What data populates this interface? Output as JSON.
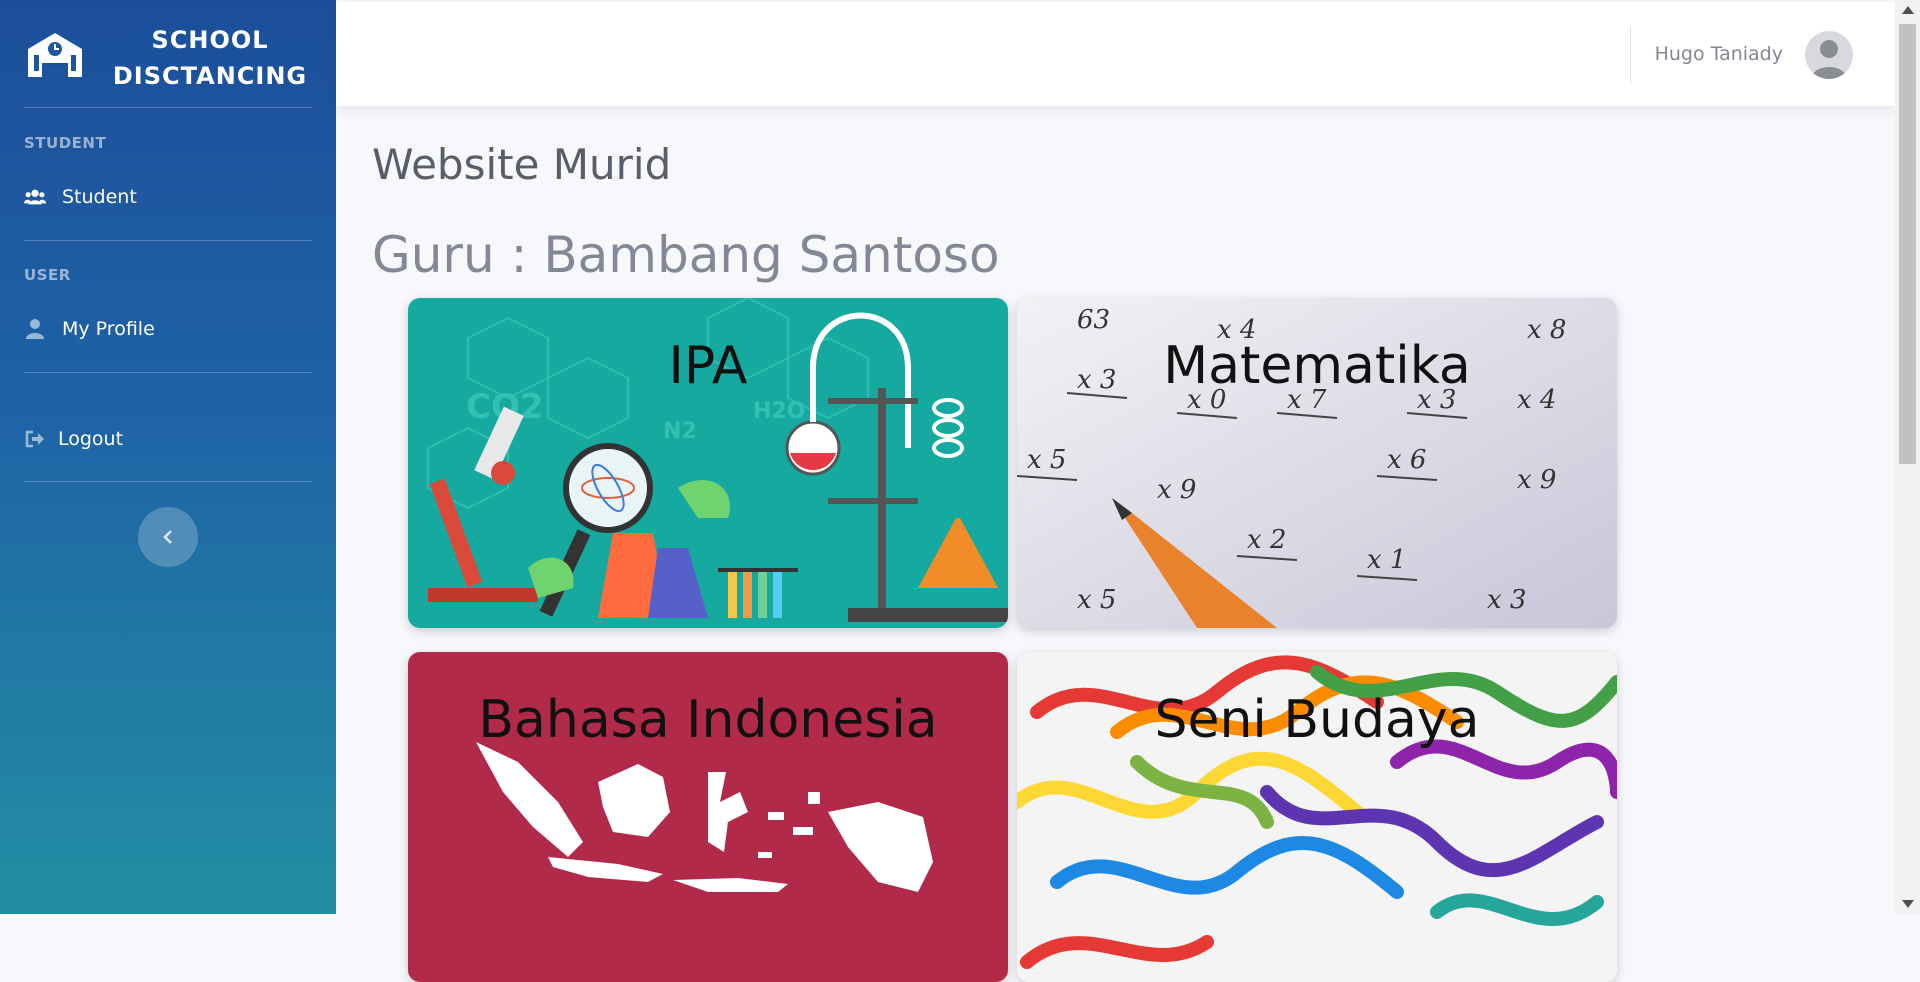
{
  "brand": {
    "line1": "SCHOOL",
    "line2": "DISCTANCING",
    "icon": "school-icon"
  },
  "sidebar": {
    "headings": {
      "student": "STUDENT",
      "user": "USER"
    },
    "items": [
      {
        "label": "Student",
        "icon": "users-icon"
      },
      {
        "label": "My Profile",
        "icon": "user-icon"
      },
      {
        "label": "Logout",
        "icon": "sign-out-icon"
      }
    ],
    "toggle_icon": "chevron-left-icon"
  },
  "topbar": {
    "user_name": "Hugo Taniady",
    "avatar_icon": "avatar-icon"
  },
  "main": {
    "title": "Website Murid",
    "teacher": "Guru : Bambang Santoso",
    "subjects": [
      {
        "name": "IPA",
        "bg": "#16a99f"
      },
      {
        "name": "Matematika",
        "bg": "#e8e8ee"
      },
      {
        "name": "Bahasa Indonesia",
        "bg": "#b22a4a"
      },
      {
        "name": "Seni Budaya",
        "bg": "#f3f3f3"
      }
    ]
  },
  "colors": {
    "sidebar_top": "#1c4f9a",
    "sidebar_bottom": "#238fa3",
    "text_muted": "#858796",
    "text_dark": "#5a5c69"
  }
}
